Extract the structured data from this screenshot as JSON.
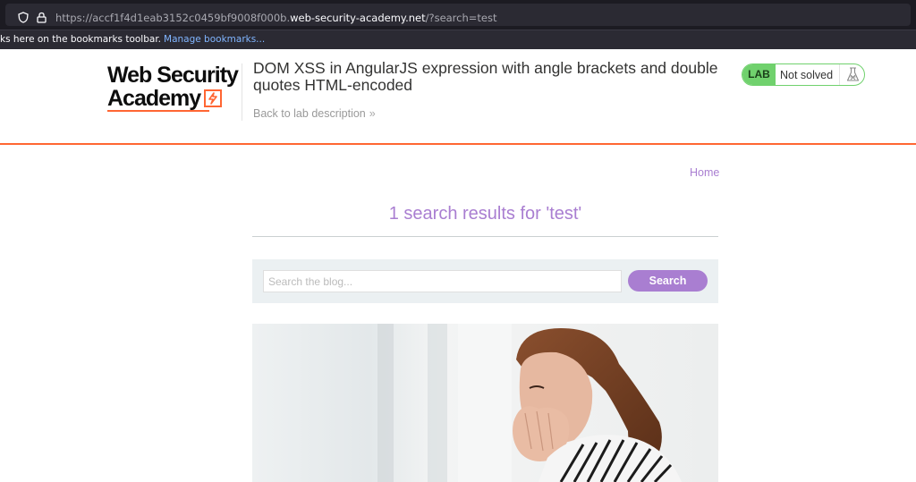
{
  "browser": {
    "url_prefix": "https://accf1f4d1eab3152c0459bf9008f000b.",
    "url_host": "web-security-academy.net",
    "url_suffix": "/?search=test",
    "bookmarks_text": "ks here on the bookmarks toolbar.",
    "bookmarks_link": "Manage bookmarks..."
  },
  "header": {
    "logo_line1": "Web Security",
    "logo_line2": "Academy",
    "lab_title": "DOM XSS in AngularJS expression with angle brackets and double quotes HTML-encoded",
    "back_link": "Back to lab description",
    "status_badge": "LAB",
    "status_text": "Not solved"
  },
  "blog": {
    "home_link": "Home",
    "results_text": "1 search results for 'test'",
    "search_placeholder": "Search the blog...",
    "search_button": "Search"
  },
  "colors": {
    "accent_orange": "#ff6633",
    "purple": "#a97ed1",
    "lab_green": "#70d16d"
  }
}
